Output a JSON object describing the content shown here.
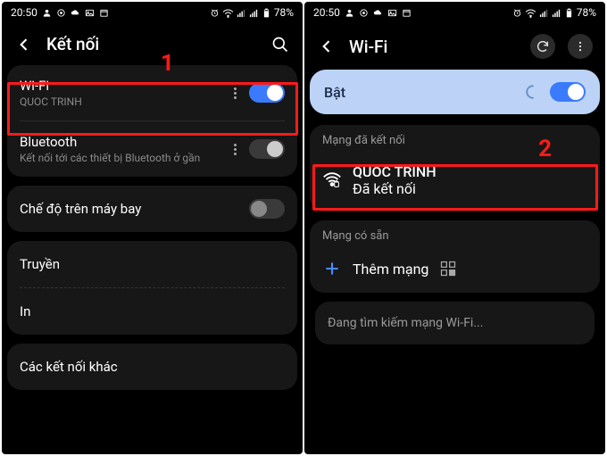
{
  "statusbar": {
    "time": "20:50",
    "battery": "78%"
  },
  "annotations": {
    "one": "1",
    "two": "2"
  },
  "left": {
    "header_title": "Kết nối",
    "wifi": {
      "title": "Wi-Fi",
      "sub": "QUOC TRINH"
    },
    "bluetooth": {
      "title": "Bluetooth",
      "sub": "Kết nối tới các thiết bị Bluetooth ở gần"
    },
    "airplane": {
      "title": "Chế độ trên máy bay"
    },
    "cast": {
      "title": "Truyền"
    },
    "print": {
      "title": "In"
    },
    "other": {
      "title": "Các kết nối khác"
    }
  },
  "right": {
    "header_title": "Wi-Fi",
    "on_label": "Bật",
    "connected_section": "Mạng đã kết nối",
    "network": {
      "name": "QUOC TRINH",
      "status": "Đã kết nối"
    },
    "available_section": "Mạng có sẵn",
    "add_network": "Thêm mạng",
    "scanning": "Đang tìm kiếm mạng Wi-Fi..."
  }
}
